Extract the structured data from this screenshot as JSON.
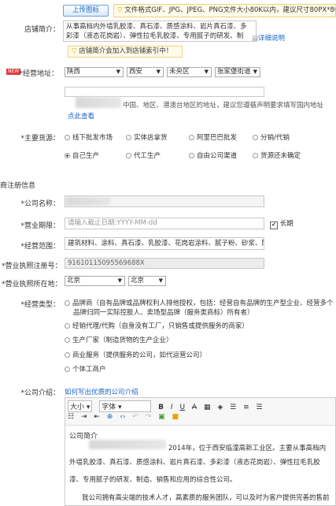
{
  "upload": {
    "button": "上传图标",
    "hint": "文件格式GIF、JPG、JPEG、PNG文件大小80K以内，建议尺寸80PX*80PX"
  },
  "shop_intro": {
    "label": "店铺简介：",
    "lines": [
      "从事高档内外墙乳胶漆、真石漆、质感涂料、岩片真石漆、多",
      "彩漆（液态花岗岩）、弹性拉毛乳胶漆、专用腻子的研发、制"
    ],
    "detail_link": "详细说明",
    "index_tip": "店铺简介会加入到店铺索引中！"
  },
  "address": {
    "badge": "NEW",
    "label": "*经营地址：",
    "province": "陕西",
    "city": "西安",
    "district": "未央区",
    "street": "张家堡街道",
    "hint": "中国、地区、港澳台地区的地址，建议您遵循声明要求填写国内地址",
    "hint_link": "点此查看"
  },
  "source": {
    "label": "*主要货源：",
    "options": [
      "线下批发市场",
      "实体店拿货",
      "阿里巴巴批发",
      "分销/代销",
      "自己生产",
      "代工生产",
      "自由公司渠道",
      "货源还未确定"
    ],
    "selected": "自己生产"
  },
  "company_section": {
    "title": "商注册信息"
  },
  "company_name": {
    "label": "*公司名称："
  },
  "license_term": {
    "label": "*营业期限：",
    "placeholder": "请输入截止日期:YYYY-MM-dd",
    "long_term": "长期"
  },
  "business_scope": {
    "label": "*经营范围：",
    "value": "建筑材料、涂料、真石漆、乳胶漆、花岗岩涂料、腻子粉、砂浆、防"
  },
  "license_no": {
    "label": "*营业执照注册号：",
    "value": "91610115095569688X"
  },
  "license_location": {
    "label": "*营业执照所在地：",
    "province": "北京",
    "city": "北京"
  },
  "operation_type": {
    "label": "*经营类型：",
    "options": [
      "品牌商（自有品牌或品牌权利人排他授权，包括：经营自有品牌的生产型企业、经营多个",
      "经销代理/代购（自身没有工厂，只销售或提供服务的商家）",
      "生产厂家（制造货物的生产企业）",
      "商业服务（提供服务的公司，如代运营公司）",
      "个体工商户"
    ],
    "option1_line2": "品牌归同一实际控股人、卖场型品牌（服务类商标）所有者）"
  },
  "company_intro": {
    "label": "*公司介绍：",
    "link": "如何写出优质的公司介绍",
    "toolbar": {
      "size": "大小",
      "font": "字体",
      "bold": "B",
      "italic": "I",
      "underline": "U",
      "strike": "A"
    },
    "heading": "公司简介",
    "lines": [
      "2014年，位于西安临潼高新工业区。主要从事高档内",
      "外墙乳胶漆、真石漆、质感涂料、岩片真石漆、多彩漆（液态花岗岩）、弹性拉毛乳胶",
      "漆、专用腻子的研发、制造、销售和应用的综合性公司。",
      "我公司拥有高尖端的技术人才，高素质的服务团队，可以及时为客户提供完善的售前"
    ]
  },
  "colors": {
    "accent": "#e4393c",
    "link": "#1a66c8",
    "tip_bg": "#fffbe8"
  }
}
